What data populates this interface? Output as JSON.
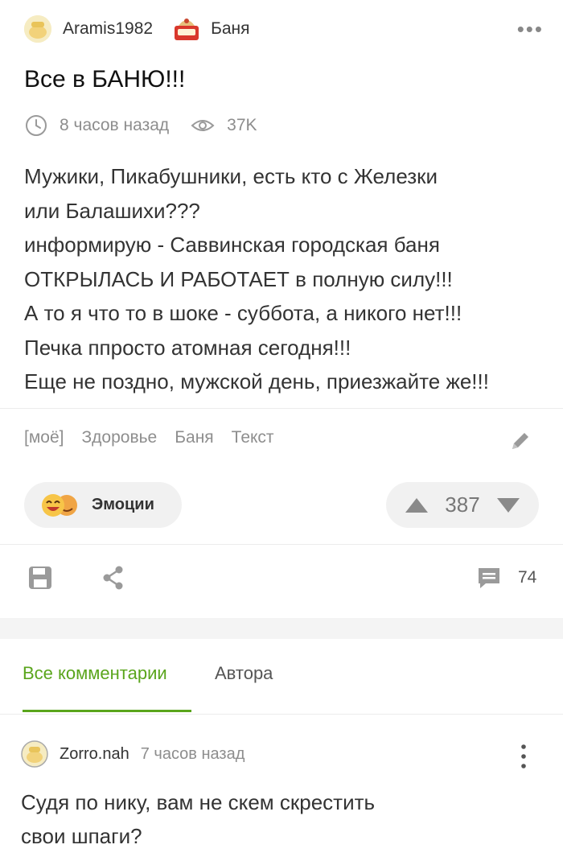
{
  "post": {
    "author": "Aramis1982",
    "community": "Баня",
    "more_label": "•••",
    "title": "Все в БАНЮ!!!",
    "time": "8 часов назад",
    "views": "37K",
    "body": "Мужики, Пикабушники, есть кто с Железки\nили Балашихи???\nинформирую - Саввинская городская баня\nОТКРЫЛАСЬ И РАБОТАЕТ в полную силу!!!\nА то я что то в шоке - суббота, а никого нет!!!\nПечка ппросто атомная сегодня!!!\nЕще не поздно, мужской день, приезжайте же!!!",
    "tags": [
      "[моё]",
      "Здоровье",
      "Баня",
      "Текст"
    ],
    "emotions_label": "Эмоции",
    "rating": "387",
    "comments_count": "74"
  },
  "tabs": {
    "all": "Все комментарии",
    "author": "Автора"
  },
  "comment": {
    "author": "Zorro.nah",
    "time": "7 часов назад",
    "text": "Судя по нику, вам не скем скрестить\nсвои шпаги?"
  },
  "colors": {
    "accent": "#5aa51c",
    "icon_gray": "#9a9a9a",
    "pill_bg": "#f1f1f1"
  },
  "icons": [
    "clock-icon",
    "eye-icon",
    "pencil-icon",
    "save-icon",
    "share-icon",
    "comment-icon",
    "arrow-up-icon",
    "arrow-down-icon",
    "vertical-dots-icon"
  ]
}
